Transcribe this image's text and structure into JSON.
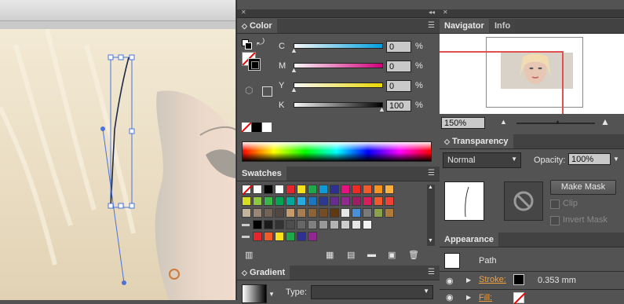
{
  "color_panel": {
    "tab": "Color",
    "channels": [
      {
        "label": "C",
        "value": "0",
        "unit": "%"
      },
      {
        "label": "M",
        "value": "0",
        "unit": "%"
      },
      {
        "label": "Y",
        "value": "0",
        "unit": "%"
      },
      {
        "label": "K",
        "value": "100",
        "unit": "%"
      }
    ],
    "spectrum_colors": [
      "#ff0000",
      "#ffff00",
      "#00ff00",
      "#00ffff",
      "#0000ff",
      "#ff00ff",
      "#ff0000"
    ]
  },
  "swatches_panel": {
    "tab": "Swatches",
    "rows": [
      [
        "none",
        "#ffffff",
        "#000000",
        "#ffffff",
        "#e3262e",
        "#f7e11b",
        "#1fa849",
        "#0f9ad6",
        "#2e3191",
        "#e5127f",
        "#ee2a24",
        "#f15a29",
        "#f7941d",
        "#fbb040"
      ],
      [
        "#d7df23",
        "#8dc63f",
        "#39b54a",
        "#00a651",
        "#00a79d",
        "#27aae1",
        "#1c75bc",
        "#2b3990",
        "#662d91",
        "#92278f",
        "#9e1f63",
        "#da1c5c",
        "#f15a29",
        "#ef4136"
      ],
      [
        "#c2b59b",
        "#998675",
        "#736357",
        "#534741",
        "#c69c6d",
        "#a67c52",
        "#8c6239",
        "#754c24",
        "#603913",
        "#e6e6e6",
        "#4a90d9",
        "#7a7a7a",
        "#8aa34a",
        "#b07a3a"
      ],
      [
        "#000000",
        "#1a1a1a",
        "#333333",
        "#4d4d4d",
        "#666666",
        "#808080",
        "#999999",
        "#b3b3b3",
        "#cccccc",
        "#e6e6e6",
        "#f2f2f2"
      ],
      [
        "#e3262e",
        "#f15a29",
        "#f7e11b",
        "#1fa849",
        "#2e3191",
        "#92278f"
      ]
    ]
  },
  "gradient_panel": {
    "tab": "Gradient",
    "type_label": "Type:"
  },
  "navigator_panel": {
    "tabs": [
      "Navigator",
      "Info"
    ],
    "zoom": "150%"
  },
  "transparency_panel": {
    "tab": "Transparency",
    "blend_mode": "Normal",
    "opacity_label": "Opacity:",
    "opacity_value": "100%",
    "make_mask_label": "Make Mask",
    "clip_label": "Clip",
    "invert_mask_label": "Invert Mask"
  },
  "appearance_panel": {
    "tab": "Appearance",
    "object_type": "Path",
    "stroke_label": "Stroke:",
    "stroke_value": "0.353 mm",
    "fill_label": "Fill:"
  },
  "colors": {
    "panel_bg": "#535353",
    "header_bg": "#424242",
    "selection_blue": "#4a74d9",
    "stroke_orange": "#f0a040",
    "navigator_red": "#e05050"
  }
}
